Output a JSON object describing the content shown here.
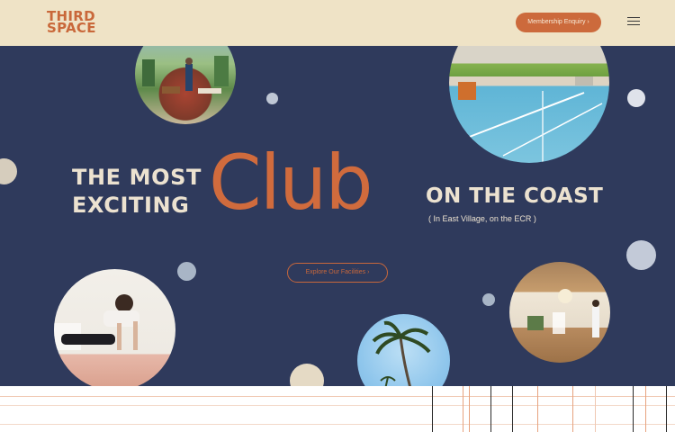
{
  "brand": {
    "logo_line1": "THIRD",
    "logo_line2": "SPACE"
  },
  "header": {
    "enquiry_label": "Membership Enquiry",
    "enquiry_arrow": "›"
  },
  "hero": {
    "heading_left_line1": "THE MOST",
    "heading_left_line2": "EXCITING",
    "heading_center": "Club",
    "heading_right": "ON THE COAST",
    "subheading": "( In East Village, on the ECR )",
    "explore_label": "Explore Our Facilities",
    "explore_arrow": "›"
  },
  "colors": {
    "navy": "#2f3a5c",
    "cream": "#efe3c6",
    "orange": "#cc6a3c",
    "light_text": "#ece2d0"
  }
}
